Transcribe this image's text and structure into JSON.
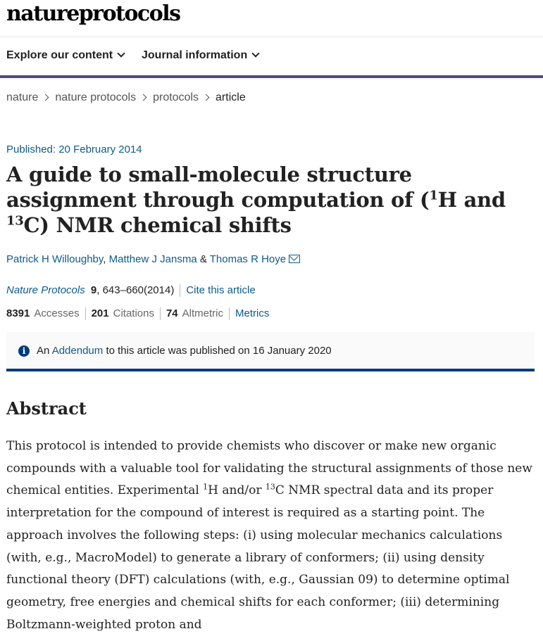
{
  "logo": {
    "text": "natureprotocols"
  },
  "nav": {
    "explore": "Explore our content",
    "journal": "Journal information"
  },
  "breadcrumb": {
    "items": [
      "nature",
      "nature protocols",
      "protocols"
    ],
    "current": "article"
  },
  "article": {
    "published": "Published: 20 February 2014",
    "title_part1": "A guide to small-molecule structure assignment through computation of (",
    "sup1": "1",
    "title_part2": "H and ",
    "sup2": "13",
    "title_part3": "C) NMR chemical shifts",
    "authors": [
      "Patrick H Willoughby",
      "Matthew J Jansma",
      "Thomas R Hoye"
    ],
    "author_sep": ",",
    "author_and": "&",
    "journal": "Nature Protocols",
    "volume": "9",
    "pages": ", 643–660(2014)",
    "cite_label": "Cite this article",
    "metrics": {
      "accesses_value": "8391",
      "accesses_label": "Accesses",
      "citations_value": "201",
      "citations_label": "Citations",
      "altmetric_value": "74",
      "altmetric_label": "Altmetric",
      "metrics_link": "Metrics"
    },
    "addendum": {
      "prefix": "An",
      "link": "Addendum",
      "suffix": "to this article was published on 16 January 2020"
    },
    "abstract_heading": "Abstract",
    "abstract": {
      "p1": "This protocol is intended to provide chemists who discover or make new organic compounds with a valuable tool for validating the structural assignments of those new chemical entities. Experimental ",
      "sup1": "1",
      "p2": "H and/or ",
      "sup2": "13",
      "p3": "C NMR spectral data and its proper interpretation for the compound of interest is required as a starting point. The approach involves the following steps: (i) using molecular mechanics calculations (with, e.g., MacroModel) to generate a library of conformers; (ii) using density functional theory (DFT) calculations (with, e.g., Gaussian 09) to determine optimal geometry, free energies and chemical shifts for each conformer; (iii) determining Boltzmann-weighted proton and"
    }
  },
  "colors": {
    "link": "#0e5b8a",
    "nav_border": "#4f4a7f",
    "addendum_border": "#003b7a"
  }
}
